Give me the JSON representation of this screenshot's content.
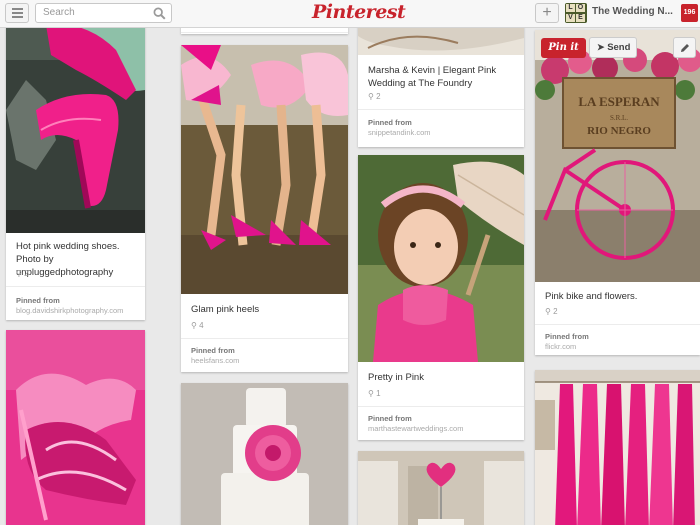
{
  "header": {
    "search_placeholder": "Search",
    "logo": "Pinterest",
    "add_label": "+",
    "profile_name": "The Wedding N...",
    "profile_thumb_letters": [
      "L",
      "O",
      "V",
      "E"
    ],
    "notification_count": "196"
  },
  "actions": {
    "pinit_label": "Pin it",
    "send_label": "Send"
  },
  "pins": {
    "p1": {
      "description": "Hot pink wedding shoes. Photo by unpluggedphotography",
      "repins": "2",
      "source_label": "Pinned from",
      "source": "blog.davidshirkphotography.com"
    },
    "p3": {
      "description": "Glam pink heels",
      "repins": "4",
      "source_label": "Pinned from",
      "source": "heelsfans.com"
    },
    "p5": {
      "description": "Marsha & Kevin | Elegant Pink Wedding at The Foundry",
      "repins": "2",
      "source_label": "Pinned from",
      "source": "snippetandink.com"
    },
    "p6": {
      "description": "Pretty in Pink",
      "repins": "1",
      "source_label": "Pinned from",
      "source": "marthastewartweddings.com"
    },
    "p8": {
      "description": "Pink bike and flowers.",
      "repins": "2",
      "source_label": "Pinned from",
      "source": "flickr.com",
      "sign_line1": "LA ESPERAN",
      "sign_line2": "S.R.L.",
      "sign_line3": "RIO NEGRO"
    }
  }
}
